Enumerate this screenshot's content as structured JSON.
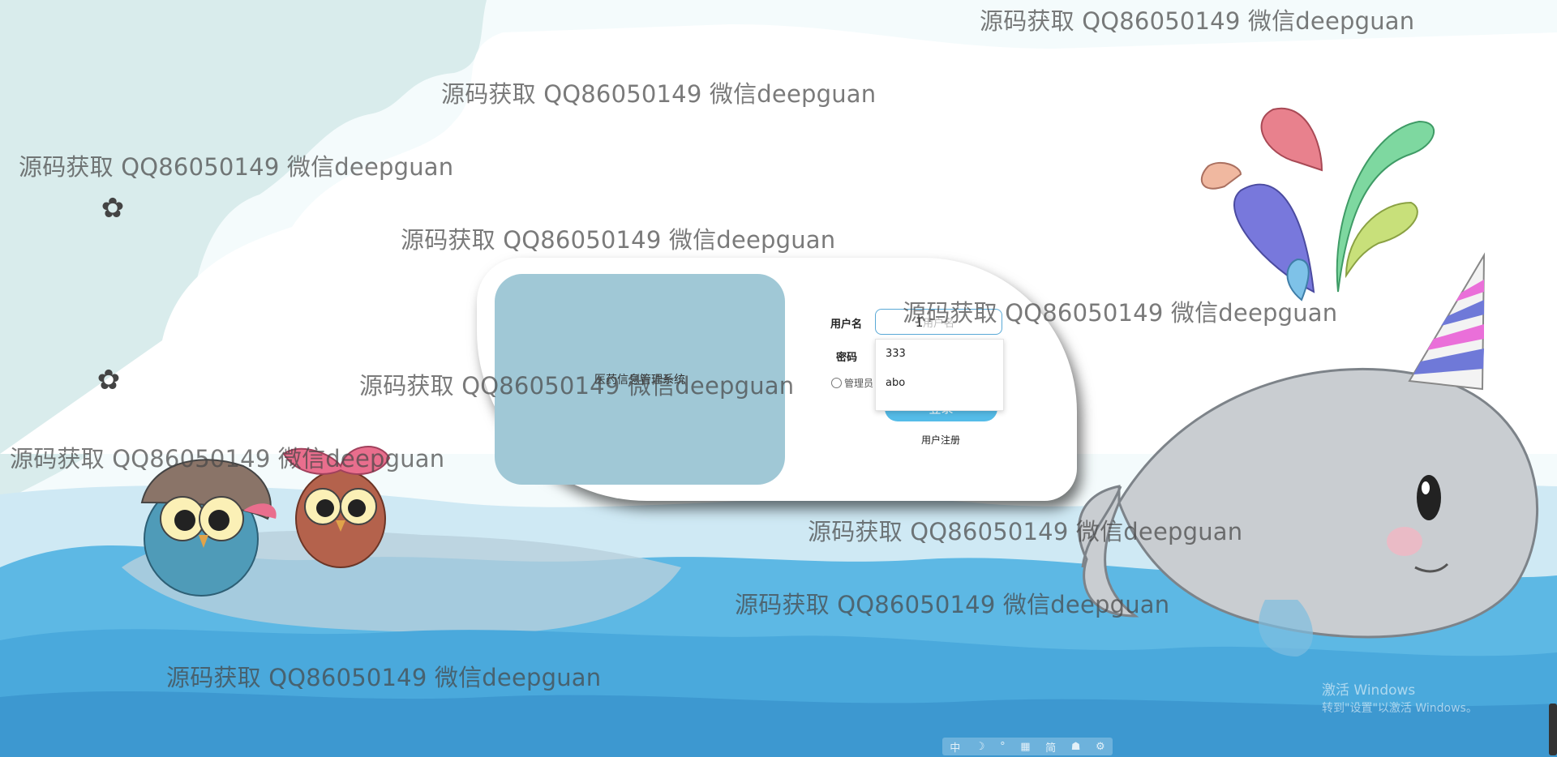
{
  "watermark_text": "源码获取 QQ86050149 微信deepguan",
  "banner": {
    "title": "医药信息管理系统"
  },
  "form": {
    "username_label": "用户名",
    "username_placeholder": "用户名",
    "password_label": "密码",
    "role_option": "管理员",
    "login_button": "登录",
    "register_link": "用户注册",
    "autocomplete": [
      "333",
      "abo"
    ]
  },
  "system": {
    "activate_line1": "激活 Windows",
    "activate_line2": "转到\"设置\"以激活 Windows。",
    "ime_items": [
      "中",
      "☽",
      "°",
      "▦",
      "简",
      "☗",
      "⚙"
    ]
  },
  "icons": {
    "puzzle": "puzzle-icon",
    "cursor": "ibeam-cursor-icon"
  }
}
